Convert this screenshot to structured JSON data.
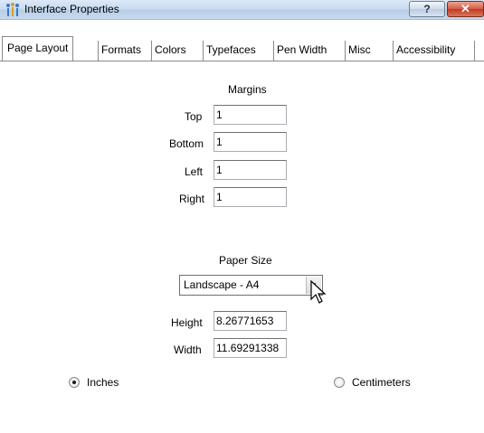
{
  "window": {
    "title": "Interface Properties",
    "help_label": "?",
    "close_label": "✕"
  },
  "tabs": [
    {
      "label": "Page Layout",
      "active": true
    },
    {
      "label": "Formats",
      "active": false
    },
    {
      "label": "Colors",
      "active": false
    },
    {
      "label": "Typefaces",
      "active": false
    },
    {
      "label": "Pen Width",
      "active": false
    },
    {
      "label": "Misc",
      "active": false
    },
    {
      "label": "Accessibility",
      "active": false
    }
  ],
  "margins": {
    "heading": "Margins",
    "top_label": "Top",
    "top_value": "1",
    "bottom_label": "Bottom",
    "bottom_value": "1",
    "left_label": "Left",
    "left_value": "1",
    "right_label": "Right",
    "right_value": "1"
  },
  "paper": {
    "heading": "Paper Size",
    "selected": "Landscape - A4",
    "height_label": "Height",
    "height_value": "8.26771653",
    "width_label": "Width",
    "width_value": "11.69291338"
  },
  "units": {
    "inches_label": "Inches",
    "inches_selected": true,
    "centimeters_label": "Centimeters",
    "centimeters_selected": false
  }
}
